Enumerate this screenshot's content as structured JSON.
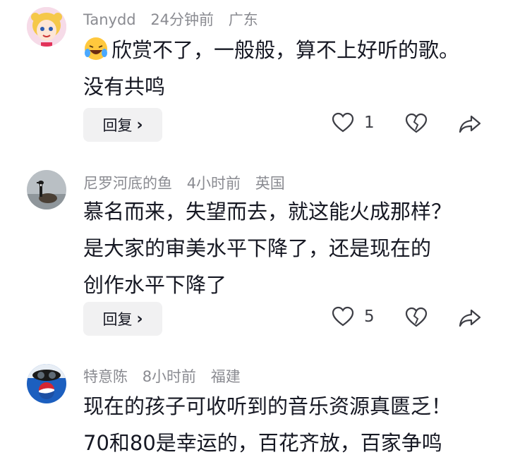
{
  "comments": [
    {
      "user": "Tanydd",
      "time": "24分钟前",
      "location": "广东",
      "emoji": "laughing-crying-emoji",
      "text_line1": "欣赏不了，一般般，算不上好听的歌。",
      "text_line2": "没有共鸣",
      "reply_label": "回复",
      "likes": "1"
    },
    {
      "user": "尼罗河底的鱼",
      "time": "4小时前",
      "location": "英国",
      "text_line1": "慕名而来，失望而去，就这能火成那样？",
      "text_line2": "是大家的审美水平下降了，还是现在的",
      "text_line3": "创作水平下降了",
      "reply_label": "回复",
      "likes": "5"
    },
    {
      "user": "特意陈",
      "time": "8小时前",
      "location": "福建",
      "text_line1": "现在的孩子可收听到的音乐资源真匮乏！",
      "text_line2": "70和80是幸运的，百花齐放，百家争鸣"
    }
  ],
  "colors": {
    "meta": "#8a8b91",
    "text": "#161823",
    "reply_bg": "#f1f1f2"
  }
}
